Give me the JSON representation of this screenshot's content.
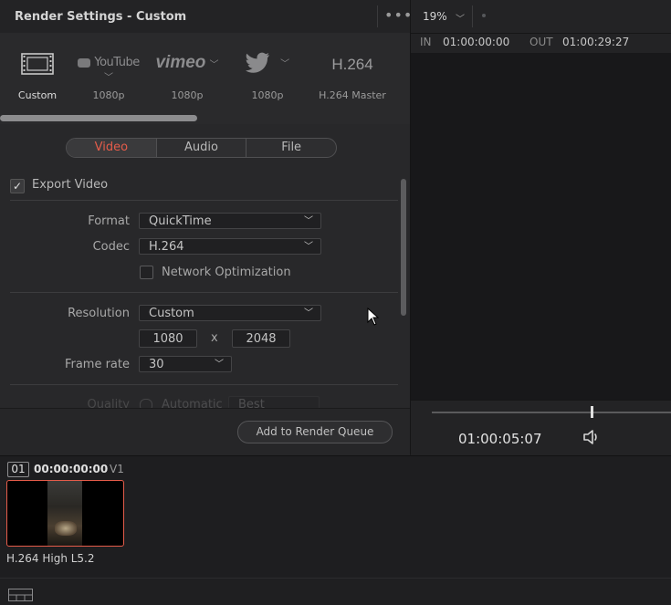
{
  "panel": {
    "title": "Render Settings - Custom",
    "more_icon": "more-horizontal-icon"
  },
  "presets": [
    {
      "name": "custom",
      "icon": "film-strip-icon",
      "label": "Custom"
    },
    {
      "name": "youtube",
      "icon": "youtube-logo",
      "logo_text": "YouTube",
      "label": "1080p"
    },
    {
      "name": "vimeo",
      "icon": "vimeo-logo",
      "logo_text": "vimeo",
      "label": "1080p"
    },
    {
      "name": "twitter",
      "icon": "twitter-bird-icon",
      "label": "1080p"
    },
    {
      "name": "h264",
      "logo_text": "H.264",
      "label": "H.264 Master"
    }
  ],
  "tabs": {
    "video": "Video",
    "audio": "Audio",
    "file": "File",
    "active": "Video"
  },
  "export_video": {
    "label": "Export Video",
    "checked": true
  },
  "format": {
    "label": "Format",
    "value": "QuickTime"
  },
  "codec": {
    "label": "Codec",
    "value": "H.264"
  },
  "network_optimization": {
    "label": "Network Optimization",
    "checked": false
  },
  "resolution": {
    "label": "Resolution",
    "value": "Custom",
    "width": "1080",
    "separator": "x",
    "height": "2048"
  },
  "frame_rate": {
    "label": "Frame rate",
    "value": "30"
  },
  "quality": {
    "label": "Quality",
    "mode": "Automatic",
    "value": "Best"
  },
  "add_to_queue": "Add to Render Queue",
  "viewer": {
    "zoom": "19%",
    "in_label": "IN",
    "in_tc": "01:00:00:00",
    "out_label": "OUT",
    "out_tc": "01:00:29:27",
    "timecode": "01:00:05:07",
    "volume_icon": "speaker-icon"
  },
  "clip": {
    "number": "01",
    "timecode": "00:00:00:00",
    "track": "V1",
    "name": "H.264 High L5.2"
  },
  "colors": {
    "accent": "#e55c4a",
    "panel_bg": "#28282a",
    "viewer_bg": "#18181a"
  }
}
